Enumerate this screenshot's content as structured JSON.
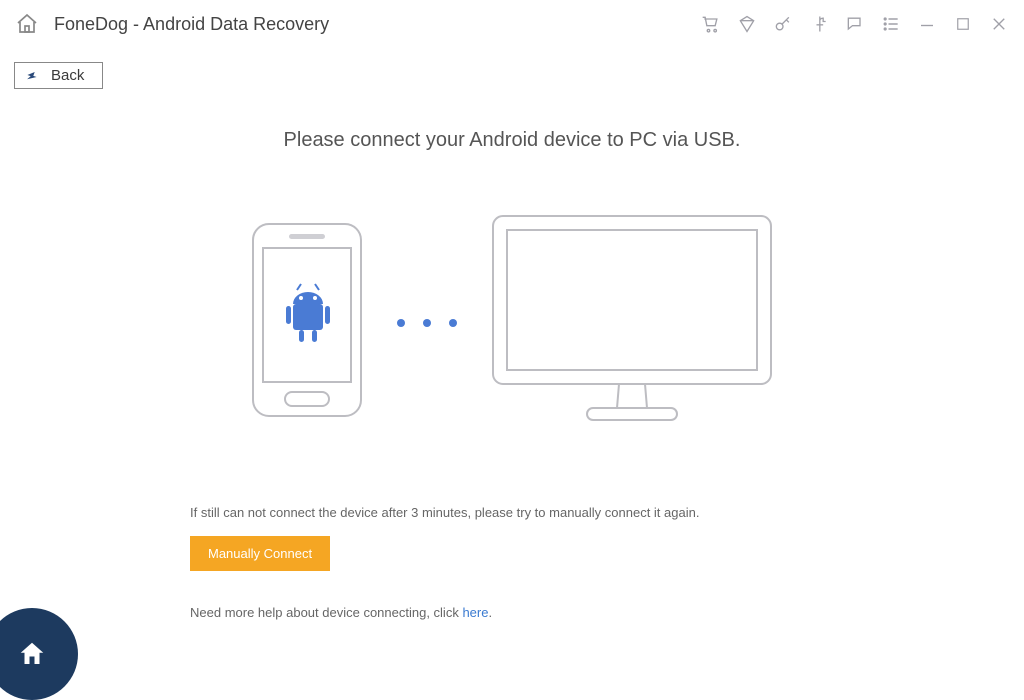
{
  "app": {
    "title": "FoneDog - Android Data Recovery"
  },
  "back": {
    "label": "Back"
  },
  "instruction": "Please connect your Android device to PC via USB.",
  "note": "If still can not connect the device after 3 minutes, please try to manually connect it again.",
  "manualConnect": {
    "label": "Manually Connect"
  },
  "help": {
    "prefix": "Need more help about device connecting, click ",
    "link": "here",
    "suffix": "."
  },
  "icons": {
    "home": "home-icon",
    "cart": "cart-icon",
    "diamond": "diamond-icon",
    "key": "key-icon",
    "social": "social-icon",
    "chat": "chat-icon",
    "menu": "menu-icon",
    "minimize": "minimize-icon",
    "maximize": "maximize-icon",
    "close": "close-icon"
  }
}
